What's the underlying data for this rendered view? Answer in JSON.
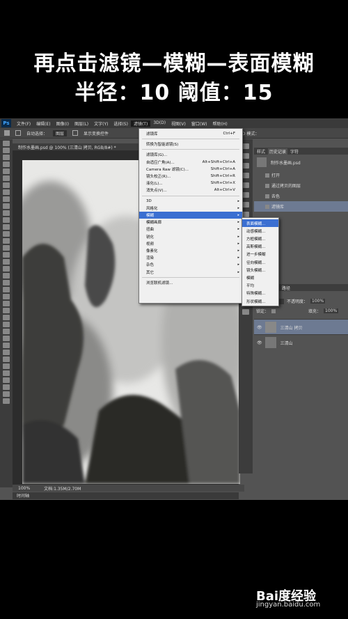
{
  "caption": {
    "line1": "再点击滤镜—模糊—表面模糊",
    "line2": "半径：10    阈值：15"
  },
  "photoshop": {
    "logo": "Ps",
    "menubar": [
      "文件(F)",
      "编辑(E)",
      "图像(I)",
      "图层(L)",
      "文字(Y)",
      "选择(S)",
      "滤镜(T)",
      "3D(D)",
      "视图(V)",
      "窗口(W)",
      "帮助(H)"
    ],
    "options": {
      "auto_select": "自动选择：",
      "target": "图层",
      "show_transform": "显示变换控件",
      "mode_3d": "3D 模式："
    },
    "doc_tab": "制作水墨画.psd @ 100% (三清山 拷贝, RGB/8#) *",
    "status": {
      "zoom": "100%",
      "doc": "文档:1.35M/2.70M"
    },
    "bottom_tab": "时间轴",
    "history_tabs": [
      "样式",
      "历史记录",
      "字符"
    ],
    "history_doc": "制作水墨画.psd",
    "history_items": [
      "打开",
      "通过拷贝的图层",
      "去色",
      "滤镜库"
    ],
    "layers_tabs": [
      "图层",
      "通道",
      "路径"
    ],
    "lock_label": "锁定：",
    "opacity_label": "不透明度：",
    "opacity_value": "100%",
    "fill_label": "填充：",
    "fill_value": "100%",
    "layers": [
      "三清山 拷贝",
      "三清山"
    ]
  },
  "filter_menu": [
    {
      "label": "滤镜库",
      "shortcut": "Ctrl+F",
      "arrow": ""
    },
    {
      "sep": true
    },
    {
      "label": "转换为智能滤镜(S)",
      "shortcut": "",
      "arrow": ""
    },
    {
      "sep": true
    },
    {
      "label": "滤镜库(G)...",
      "shortcut": "",
      "arrow": ""
    },
    {
      "label": "自适应广角(A)...",
      "shortcut": "Alt+Shift+Ctrl+A",
      "arrow": ""
    },
    {
      "label": "Camera Raw 滤镜(C)...",
      "shortcut": "Shift+Ctrl+A",
      "arrow": ""
    },
    {
      "label": "镜头校正(R)...",
      "shortcut": "Shift+Ctrl+R",
      "arrow": ""
    },
    {
      "label": "液化(L)...",
      "shortcut": "Shift+Ctrl+X",
      "arrow": ""
    },
    {
      "label": "消失点(V)...",
      "shortcut": "Alt+Ctrl+V",
      "arrow": ""
    },
    {
      "sep": true
    },
    {
      "label": "3D",
      "shortcut": "",
      "arrow": "▸"
    },
    {
      "label": "风格化",
      "shortcut": "",
      "arrow": "▸"
    },
    {
      "label": "模糊",
      "shortcut": "",
      "arrow": "▸",
      "highlight": true
    },
    {
      "label": "模糊画廊",
      "shortcut": "",
      "arrow": "▸"
    },
    {
      "label": "扭曲",
      "shortcut": "",
      "arrow": "▸"
    },
    {
      "label": "锐化",
      "shortcut": "",
      "arrow": "▸"
    },
    {
      "label": "视频",
      "shortcut": "",
      "arrow": "▸"
    },
    {
      "label": "像素化",
      "shortcut": "",
      "arrow": "▸"
    },
    {
      "label": "渲染",
      "shortcut": "",
      "arrow": "▸"
    },
    {
      "label": "杂色",
      "shortcut": "",
      "arrow": "▸"
    },
    {
      "label": "其它",
      "shortcut": "",
      "arrow": "▸"
    },
    {
      "sep": true
    },
    {
      "label": "浏览联机滤镜...",
      "shortcut": "",
      "arrow": ""
    }
  ],
  "blur_submenu": [
    {
      "label": "表面模糊...",
      "highlight": true
    },
    {
      "label": "动感模糊..."
    },
    {
      "label": "方框模糊..."
    },
    {
      "label": "高斯模糊..."
    },
    {
      "label": "进一步模糊"
    },
    {
      "label": "径向模糊..."
    },
    {
      "label": "镜头模糊..."
    },
    {
      "label": "模糊"
    },
    {
      "label": "平均"
    },
    {
      "label": "特殊模糊..."
    },
    {
      "label": "形状模糊..."
    }
  ],
  "watermark": {
    "brand": "Bai度经验",
    "url": "jingyan.baidu.com"
  }
}
